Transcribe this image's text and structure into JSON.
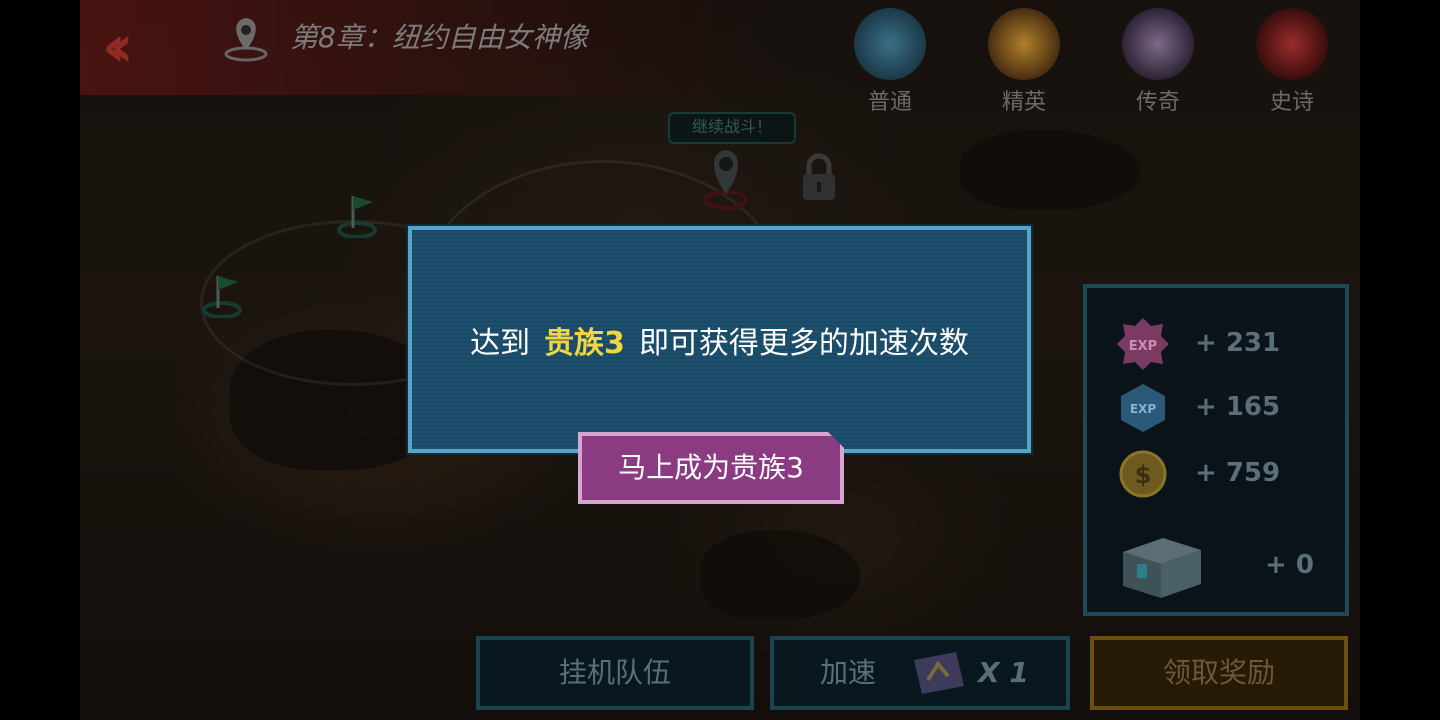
{
  "header": {
    "chapter_title": "第8章：纽约自由女神像"
  },
  "difficulty_tabs": [
    {
      "label": "普通",
      "color": "#3a6f86"
    },
    {
      "label": "精英",
      "color": "#b0802a"
    },
    {
      "label": "传奇",
      "color": "#7e6a8a"
    },
    {
      "label": "史诗",
      "color": "#9a2a2a"
    }
  ],
  "map": {
    "continue_bubble": "继续战斗！"
  },
  "rewards": {
    "items": [
      {
        "icon": "exp-pink-badge-icon",
        "value": "+ 231"
      },
      {
        "icon": "exp-blue-badge-icon",
        "value": "+ 165"
      },
      {
        "icon": "gold-coin-icon",
        "value": "+ 759"
      },
      {
        "icon": "treasure-chest-icon",
        "value": "+ 0"
      }
    ]
  },
  "bottom": {
    "idle_team": "挂机队伍",
    "speedup": "加速",
    "speedup_count": "X 1",
    "claim": "领取奖励"
  },
  "dialog": {
    "prefix": "达到",
    "highlight": "贵族3",
    "suffix": "即可获得更多的加速次数",
    "button": "马上成为贵族3"
  },
  "colors": {
    "dialog_bg": "#1d4f6f",
    "dialog_border": "#56a5c4",
    "highlight": "#f2d640",
    "vip_button": "#8a3b82"
  }
}
